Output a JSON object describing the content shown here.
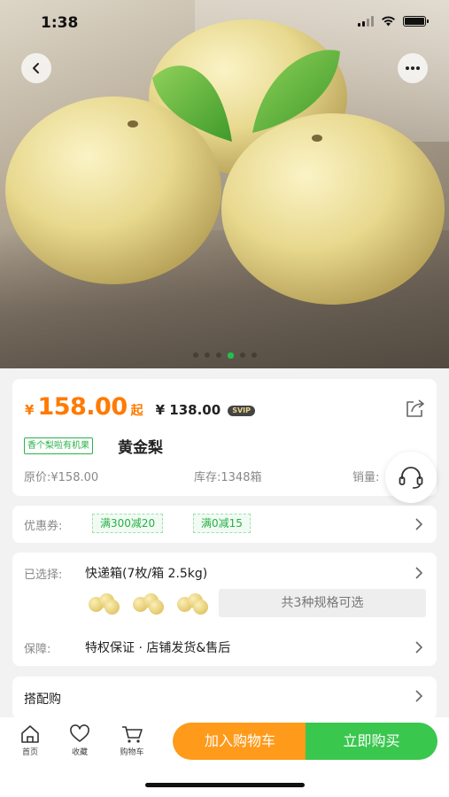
{
  "status": {
    "time": "1:38"
  },
  "carousel": {
    "count": 6,
    "active": 3
  },
  "product": {
    "currency": "¥",
    "price": "158.00",
    "price_suffix": "起",
    "svip_price": "¥ 138.00",
    "svip_badge": "SVIP",
    "tag": "香个梨啦有机果",
    "name": "黄金梨",
    "original_price": "原价:¥158.00",
    "stock": "库存:1348箱",
    "sales": "销量:"
  },
  "coupons": {
    "label": "优惠券:",
    "items": [
      "满300减20",
      "满0减15"
    ]
  },
  "spec": {
    "selected_label": "已选择:",
    "selected_value": "快递箱(7枚/箱 2.5kg)",
    "options_button": "共3种规格可选",
    "guarantee_label": "保障:",
    "guarantee_value": "特权保证 · 店铺发货&售后"
  },
  "combo": {
    "label": "搭配购"
  },
  "bottom": {
    "home": "首页",
    "favorite": "收藏",
    "cart": "购物车",
    "add_to_cart": "加入购物车",
    "buy_now": "立即购买"
  },
  "colors": {
    "accent_orange": "#ff7a00",
    "buy_green": "#3ac74e",
    "cart_orange": "#ff9a1a"
  },
  "icons": [
    "back-icon",
    "more-icon",
    "share-icon",
    "headset-icon",
    "chevron-right-icon",
    "home-icon",
    "heart-icon",
    "cart-icon"
  ]
}
